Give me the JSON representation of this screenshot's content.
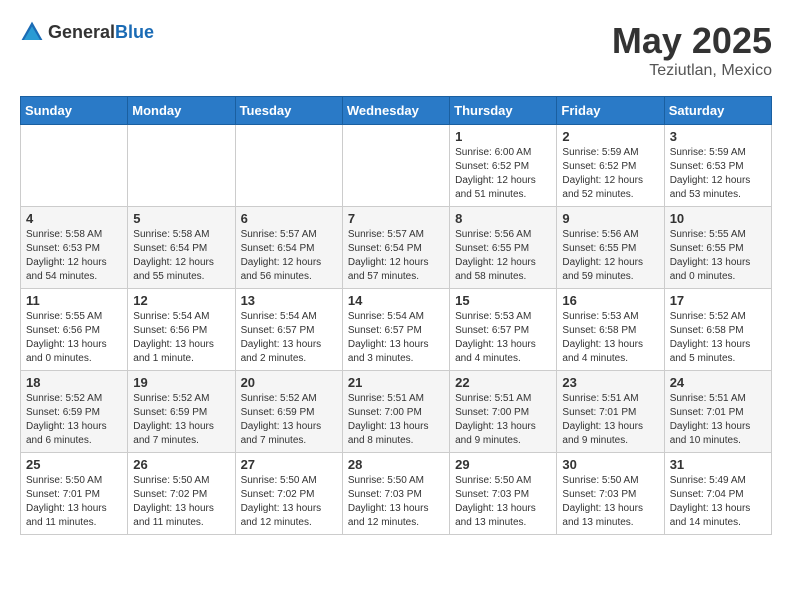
{
  "header": {
    "logo_general": "General",
    "logo_blue": "Blue",
    "month": "May 2025",
    "location": "Teziutlan, Mexico"
  },
  "days_of_week": [
    "Sunday",
    "Monday",
    "Tuesday",
    "Wednesday",
    "Thursday",
    "Friday",
    "Saturday"
  ],
  "weeks": [
    [
      {
        "day": "",
        "text": ""
      },
      {
        "day": "",
        "text": ""
      },
      {
        "day": "",
        "text": ""
      },
      {
        "day": "",
        "text": ""
      },
      {
        "day": "1",
        "text": "Sunrise: 6:00 AM\nSunset: 6:52 PM\nDaylight: 12 hours\nand 51 minutes."
      },
      {
        "day": "2",
        "text": "Sunrise: 5:59 AM\nSunset: 6:52 PM\nDaylight: 12 hours\nand 52 minutes."
      },
      {
        "day": "3",
        "text": "Sunrise: 5:59 AM\nSunset: 6:53 PM\nDaylight: 12 hours\nand 53 minutes."
      }
    ],
    [
      {
        "day": "4",
        "text": "Sunrise: 5:58 AM\nSunset: 6:53 PM\nDaylight: 12 hours\nand 54 minutes."
      },
      {
        "day": "5",
        "text": "Sunrise: 5:58 AM\nSunset: 6:54 PM\nDaylight: 12 hours\nand 55 minutes."
      },
      {
        "day": "6",
        "text": "Sunrise: 5:57 AM\nSunset: 6:54 PM\nDaylight: 12 hours\nand 56 minutes."
      },
      {
        "day": "7",
        "text": "Sunrise: 5:57 AM\nSunset: 6:54 PM\nDaylight: 12 hours\nand 57 minutes."
      },
      {
        "day": "8",
        "text": "Sunrise: 5:56 AM\nSunset: 6:55 PM\nDaylight: 12 hours\nand 58 minutes."
      },
      {
        "day": "9",
        "text": "Sunrise: 5:56 AM\nSunset: 6:55 PM\nDaylight: 12 hours\nand 59 minutes."
      },
      {
        "day": "10",
        "text": "Sunrise: 5:55 AM\nSunset: 6:55 PM\nDaylight: 13 hours\nand 0 minutes."
      }
    ],
    [
      {
        "day": "11",
        "text": "Sunrise: 5:55 AM\nSunset: 6:56 PM\nDaylight: 13 hours\nand 0 minutes."
      },
      {
        "day": "12",
        "text": "Sunrise: 5:54 AM\nSunset: 6:56 PM\nDaylight: 13 hours\nand 1 minute."
      },
      {
        "day": "13",
        "text": "Sunrise: 5:54 AM\nSunset: 6:57 PM\nDaylight: 13 hours\nand 2 minutes."
      },
      {
        "day": "14",
        "text": "Sunrise: 5:54 AM\nSunset: 6:57 PM\nDaylight: 13 hours\nand 3 minutes."
      },
      {
        "day": "15",
        "text": "Sunrise: 5:53 AM\nSunset: 6:57 PM\nDaylight: 13 hours\nand 4 minutes."
      },
      {
        "day": "16",
        "text": "Sunrise: 5:53 AM\nSunset: 6:58 PM\nDaylight: 13 hours\nand 4 minutes."
      },
      {
        "day": "17",
        "text": "Sunrise: 5:52 AM\nSunset: 6:58 PM\nDaylight: 13 hours\nand 5 minutes."
      }
    ],
    [
      {
        "day": "18",
        "text": "Sunrise: 5:52 AM\nSunset: 6:59 PM\nDaylight: 13 hours\nand 6 minutes."
      },
      {
        "day": "19",
        "text": "Sunrise: 5:52 AM\nSunset: 6:59 PM\nDaylight: 13 hours\nand 7 minutes."
      },
      {
        "day": "20",
        "text": "Sunrise: 5:52 AM\nSunset: 6:59 PM\nDaylight: 13 hours\nand 7 minutes."
      },
      {
        "day": "21",
        "text": "Sunrise: 5:51 AM\nSunset: 7:00 PM\nDaylight: 13 hours\nand 8 minutes."
      },
      {
        "day": "22",
        "text": "Sunrise: 5:51 AM\nSunset: 7:00 PM\nDaylight: 13 hours\nand 9 minutes."
      },
      {
        "day": "23",
        "text": "Sunrise: 5:51 AM\nSunset: 7:01 PM\nDaylight: 13 hours\nand 9 minutes."
      },
      {
        "day": "24",
        "text": "Sunrise: 5:51 AM\nSunset: 7:01 PM\nDaylight: 13 hours\nand 10 minutes."
      }
    ],
    [
      {
        "day": "25",
        "text": "Sunrise: 5:50 AM\nSunset: 7:01 PM\nDaylight: 13 hours\nand 11 minutes."
      },
      {
        "day": "26",
        "text": "Sunrise: 5:50 AM\nSunset: 7:02 PM\nDaylight: 13 hours\nand 11 minutes."
      },
      {
        "day": "27",
        "text": "Sunrise: 5:50 AM\nSunset: 7:02 PM\nDaylight: 13 hours\nand 12 minutes."
      },
      {
        "day": "28",
        "text": "Sunrise: 5:50 AM\nSunset: 7:03 PM\nDaylight: 13 hours\nand 12 minutes."
      },
      {
        "day": "29",
        "text": "Sunrise: 5:50 AM\nSunset: 7:03 PM\nDaylight: 13 hours\nand 13 minutes."
      },
      {
        "day": "30",
        "text": "Sunrise: 5:50 AM\nSunset: 7:03 PM\nDaylight: 13 hours\nand 13 minutes."
      },
      {
        "day": "31",
        "text": "Sunrise: 5:49 AM\nSunset: 7:04 PM\nDaylight: 13 hours\nand 14 minutes."
      }
    ]
  ]
}
